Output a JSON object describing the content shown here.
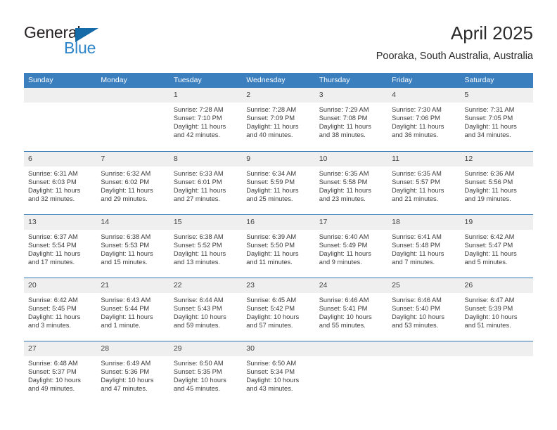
{
  "brand": {
    "name_part1": "General",
    "name_part2": "Blue",
    "triangle_icon": "brand-triangle-icon",
    "color_dark": "#231f20",
    "color_blue": "#2e84c8"
  },
  "header": {
    "title": "April 2025",
    "subtitle": "Pooraka, South Australia, Australia",
    "accent_color": "#3b7fbf"
  },
  "calendar": {
    "weekday_headers": [
      "Sunday",
      "Monday",
      "Tuesday",
      "Wednesday",
      "Thursday",
      "Friday",
      "Saturday"
    ],
    "header_bg": "#3b7fbf",
    "header_text_color": "#ffffff",
    "daynum_bg": "#efefef",
    "row_border_color": "#2f76b5",
    "weeks": [
      [
        {
          "day": "",
          "sunrise": "",
          "sunset": "",
          "daylight1": "",
          "daylight2": ""
        },
        {
          "day": "",
          "sunrise": "",
          "sunset": "",
          "daylight1": "",
          "daylight2": ""
        },
        {
          "day": "1",
          "sunrise": "Sunrise: 7:28 AM",
          "sunset": "Sunset: 7:10 PM",
          "daylight1": "Daylight: 11 hours",
          "daylight2": "and 42 minutes."
        },
        {
          "day": "2",
          "sunrise": "Sunrise: 7:28 AM",
          "sunset": "Sunset: 7:09 PM",
          "daylight1": "Daylight: 11 hours",
          "daylight2": "and 40 minutes."
        },
        {
          "day": "3",
          "sunrise": "Sunrise: 7:29 AM",
          "sunset": "Sunset: 7:08 PM",
          "daylight1": "Daylight: 11 hours",
          "daylight2": "and 38 minutes."
        },
        {
          "day": "4",
          "sunrise": "Sunrise: 7:30 AM",
          "sunset": "Sunset: 7:06 PM",
          "daylight1": "Daylight: 11 hours",
          "daylight2": "and 36 minutes."
        },
        {
          "day": "5",
          "sunrise": "Sunrise: 7:31 AM",
          "sunset": "Sunset: 7:05 PM",
          "daylight1": "Daylight: 11 hours",
          "daylight2": "and 34 minutes."
        }
      ],
      [
        {
          "day": "6",
          "sunrise": "Sunrise: 6:31 AM",
          "sunset": "Sunset: 6:03 PM",
          "daylight1": "Daylight: 11 hours",
          "daylight2": "and 32 minutes."
        },
        {
          "day": "7",
          "sunrise": "Sunrise: 6:32 AM",
          "sunset": "Sunset: 6:02 PM",
          "daylight1": "Daylight: 11 hours",
          "daylight2": "and 29 minutes."
        },
        {
          "day": "8",
          "sunrise": "Sunrise: 6:33 AM",
          "sunset": "Sunset: 6:01 PM",
          "daylight1": "Daylight: 11 hours",
          "daylight2": "and 27 minutes."
        },
        {
          "day": "9",
          "sunrise": "Sunrise: 6:34 AM",
          "sunset": "Sunset: 5:59 PM",
          "daylight1": "Daylight: 11 hours",
          "daylight2": "and 25 minutes."
        },
        {
          "day": "10",
          "sunrise": "Sunrise: 6:35 AM",
          "sunset": "Sunset: 5:58 PM",
          "daylight1": "Daylight: 11 hours",
          "daylight2": "and 23 minutes."
        },
        {
          "day": "11",
          "sunrise": "Sunrise: 6:35 AM",
          "sunset": "Sunset: 5:57 PM",
          "daylight1": "Daylight: 11 hours",
          "daylight2": "and 21 minutes."
        },
        {
          "day": "12",
          "sunrise": "Sunrise: 6:36 AM",
          "sunset": "Sunset: 5:56 PM",
          "daylight1": "Daylight: 11 hours",
          "daylight2": "and 19 minutes."
        }
      ],
      [
        {
          "day": "13",
          "sunrise": "Sunrise: 6:37 AM",
          "sunset": "Sunset: 5:54 PM",
          "daylight1": "Daylight: 11 hours",
          "daylight2": "and 17 minutes."
        },
        {
          "day": "14",
          "sunrise": "Sunrise: 6:38 AM",
          "sunset": "Sunset: 5:53 PM",
          "daylight1": "Daylight: 11 hours",
          "daylight2": "and 15 minutes."
        },
        {
          "day": "15",
          "sunrise": "Sunrise: 6:38 AM",
          "sunset": "Sunset: 5:52 PM",
          "daylight1": "Daylight: 11 hours",
          "daylight2": "and 13 minutes."
        },
        {
          "day": "16",
          "sunrise": "Sunrise: 6:39 AM",
          "sunset": "Sunset: 5:50 PM",
          "daylight1": "Daylight: 11 hours",
          "daylight2": "and 11 minutes."
        },
        {
          "day": "17",
          "sunrise": "Sunrise: 6:40 AM",
          "sunset": "Sunset: 5:49 PM",
          "daylight1": "Daylight: 11 hours",
          "daylight2": "and 9 minutes."
        },
        {
          "day": "18",
          "sunrise": "Sunrise: 6:41 AM",
          "sunset": "Sunset: 5:48 PM",
          "daylight1": "Daylight: 11 hours",
          "daylight2": "and 7 minutes."
        },
        {
          "day": "19",
          "sunrise": "Sunrise: 6:42 AM",
          "sunset": "Sunset: 5:47 PM",
          "daylight1": "Daylight: 11 hours",
          "daylight2": "and 5 minutes."
        }
      ],
      [
        {
          "day": "20",
          "sunrise": "Sunrise: 6:42 AM",
          "sunset": "Sunset: 5:45 PM",
          "daylight1": "Daylight: 11 hours",
          "daylight2": "and 3 minutes."
        },
        {
          "day": "21",
          "sunrise": "Sunrise: 6:43 AM",
          "sunset": "Sunset: 5:44 PM",
          "daylight1": "Daylight: 11 hours",
          "daylight2": "and 1 minute."
        },
        {
          "day": "22",
          "sunrise": "Sunrise: 6:44 AM",
          "sunset": "Sunset: 5:43 PM",
          "daylight1": "Daylight: 10 hours",
          "daylight2": "and 59 minutes."
        },
        {
          "day": "23",
          "sunrise": "Sunrise: 6:45 AM",
          "sunset": "Sunset: 5:42 PM",
          "daylight1": "Daylight: 10 hours",
          "daylight2": "and 57 minutes."
        },
        {
          "day": "24",
          "sunrise": "Sunrise: 6:46 AM",
          "sunset": "Sunset: 5:41 PM",
          "daylight1": "Daylight: 10 hours",
          "daylight2": "and 55 minutes."
        },
        {
          "day": "25",
          "sunrise": "Sunrise: 6:46 AM",
          "sunset": "Sunset: 5:40 PM",
          "daylight1": "Daylight: 10 hours",
          "daylight2": "and 53 minutes."
        },
        {
          "day": "26",
          "sunrise": "Sunrise: 6:47 AM",
          "sunset": "Sunset: 5:39 PM",
          "daylight1": "Daylight: 10 hours",
          "daylight2": "and 51 minutes."
        }
      ],
      [
        {
          "day": "27",
          "sunrise": "Sunrise: 6:48 AM",
          "sunset": "Sunset: 5:37 PM",
          "daylight1": "Daylight: 10 hours",
          "daylight2": "and 49 minutes."
        },
        {
          "day": "28",
          "sunrise": "Sunrise: 6:49 AM",
          "sunset": "Sunset: 5:36 PM",
          "daylight1": "Daylight: 10 hours",
          "daylight2": "and 47 minutes."
        },
        {
          "day": "29",
          "sunrise": "Sunrise: 6:50 AM",
          "sunset": "Sunset: 5:35 PM",
          "daylight1": "Daylight: 10 hours",
          "daylight2": "and 45 minutes."
        },
        {
          "day": "30",
          "sunrise": "Sunrise: 6:50 AM",
          "sunset": "Sunset: 5:34 PM",
          "daylight1": "Daylight: 10 hours",
          "daylight2": "and 43 minutes."
        },
        {
          "day": "",
          "sunrise": "",
          "sunset": "",
          "daylight1": "",
          "daylight2": ""
        },
        {
          "day": "",
          "sunrise": "",
          "sunset": "",
          "daylight1": "",
          "daylight2": ""
        },
        {
          "day": "",
          "sunrise": "",
          "sunset": "",
          "daylight1": "",
          "daylight2": ""
        }
      ]
    ]
  }
}
